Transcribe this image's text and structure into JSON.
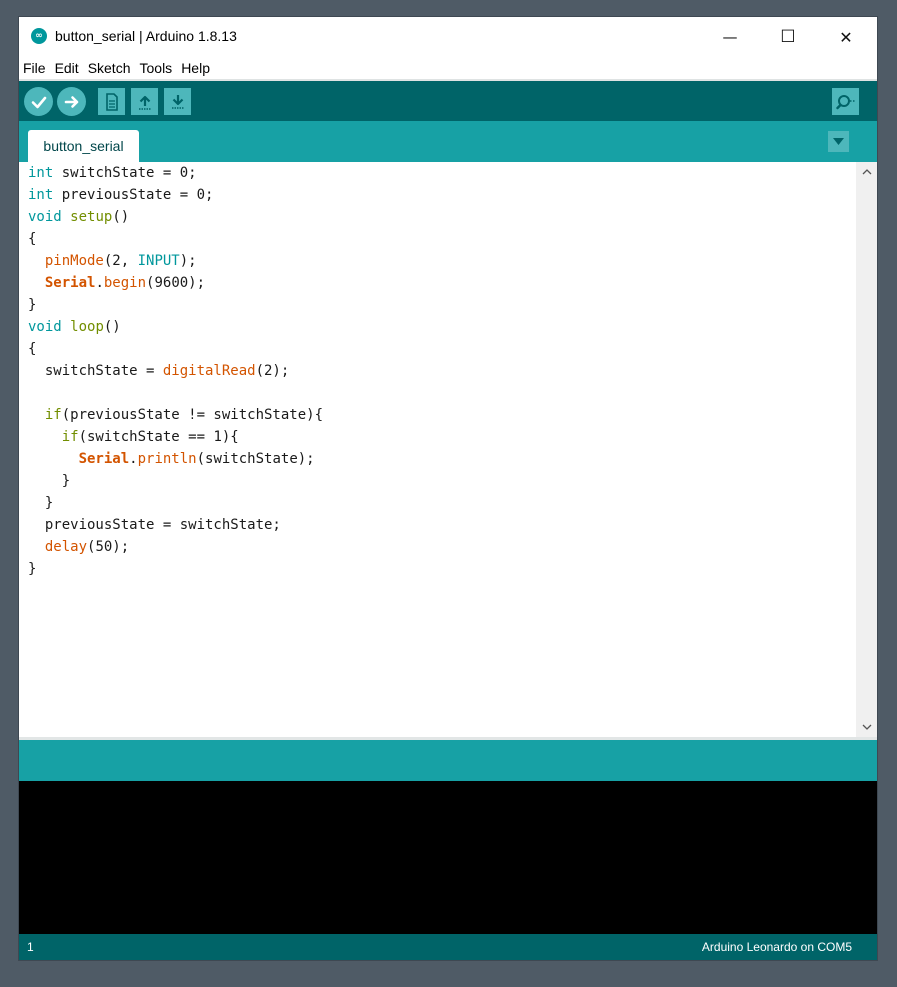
{
  "window": {
    "title": "button_serial | Arduino 1.8.13",
    "minimize_glyph": "—",
    "maximize_glyph": "☐",
    "close_glyph": "✕"
  },
  "app_icon": "∞",
  "menu": [
    "File",
    "Edit",
    "Sketch",
    "Tools",
    "Help"
  ],
  "toolbar": {
    "buttons": [
      "verify-icon",
      "upload-icon",
      "new-icon",
      "open-icon",
      "save-icon",
      "serial-monitor-icon"
    ]
  },
  "tab": {
    "label": "button_serial"
  },
  "code": [
    [
      [
        "int",
        "type"
      ],
      [
        " switchState = 0;",
        ""
      ]
    ],
    [
      [
        "int",
        "type"
      ],
      [
        " previousState = 0;",
        ""
      ]
    ],
    [
      [
        "void",
        "type"
      ],
      [
        " ",
        ""
      ],
      [
        "setup",
        "ctrl"
      ],
      [
        "()",
        ""
      ]
    ],
    [
      [
        "{",
        ""
      ]
    ],
    [
      [
        "  ",
        ""
      ],
      [
        "pinMode",
        "fn"
      ],
      [
        "(2, ",
        ""
      ],
      [
        "INPUT",
        "const"
      ],
      [
        ");",
        ""
      ]
    ],
    [
      [
        "  ",
        ""
      ],
      [
        "Serial",
        "class"
      ],
      [
        ".",
        ""
      ],
      [
        "begin",
        "fn"
      ],
      [
        "(9600);",
        ""
      ]
    ],
    [
      [
        "}",
        ""
      ]
    ],
    [
      [
        "void",
        "type"
      ],
      [
        " ",
        ""
      ],
      [
        "loop",
        "ctrl"
      ],
      [
        "()",
        ""
      ]
    ],
    [
      [
        "{",
        ""
      ]
    ],
    [
      [
        "  switchState = ",
        ""
      ],
      [
        "digitalRead",
        "fn"
      ],
      [
        "(2);",
        ""
      ]
    ],
    [
      [
        "",
        ""
      ]
    ],
    [
      [
        "  ",
        ""
      ],
      [
        "if",
        "ctrl"
      ],
      [
        "(previousState != switchState){",
        ""
      ]
    ],
    [
      [
        "    ",
        ""
      ],
      [
        "if",
        "ctrl"
      ],
      [
        "(switchState == 1){",
        ""
      ]
    ],
    [
      [
        "      ",
        ""
      ],
      [
        "Serial",
        "class"
      ],
      [
        ".",
        ""
      ],
      [
        "println",
        "fn"
      ],
      [
        "(switchState);",
        ""
      ]
    ],
    [
      [
        "    }",
        ""
      ]
    ],
    [
      [
        "  }",
        ""
      ]
    ],
    [
      [
        "  previousState = switchState;",
        ""
      ]
    ],
    [
      [
        "  ",
        ""
      ],
      [
        "delay",
        "fn"
      ],
      [
        "(50);",
        ""
      ]
    ],
    [
      [
        "}",
        ""
      ]
    ]
  ],
  "status": {
    "line": "1",
    "board": "Arduino Leonardo on COM5"
  },
  "colors": {
    "toolbar": "#006468",
    "tabbar": "#17a1a5",
    "button": "#4db7bb",
    "keyword_type": "#00979c",
    "keyword_ctrl": "#728e00",
    "function": "#d35400"
  }
}
